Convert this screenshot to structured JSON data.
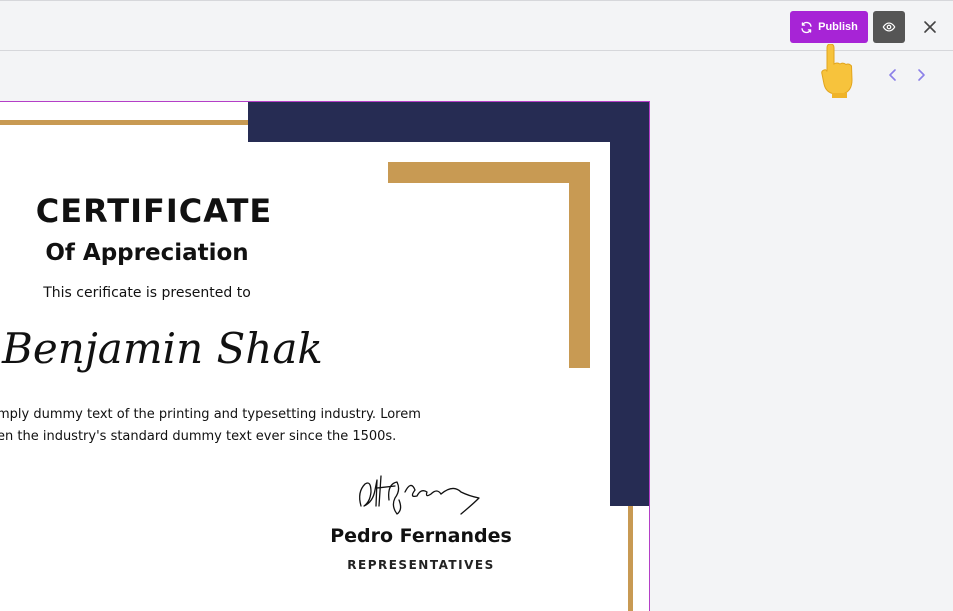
{
  "toolbar": {
    "publish_label": "Publish",
    "icons": {
      "publish": "refresh-icon",
      "preview": "eye-icon",
      "close": "close-icon",
      "prev": "chevron-left-icon",
      "next": "chevron-right-icon",
      "pointer": "pointing-hand-icon"
    }
  },
  "certificate": {
    "title": "CERTIFICATE",
    "subtitle": "Of Appreciation",
    "presented_to": "This cerificate is presented to",
    "recipient_name": "Benjamin Shak",
    "body_line_1": "mply dummy text of the printing and typesetting industry. Lorem",
    "body_line_2": "en the industry's standard dummy text ever since the 1500s.",
    "representative_name": "Pedro Fernandes",
    "representative_title": "REPRESENTATIVES"
  },
  "colors": {
    "accent": "#a724d6",
    "navy": "#262c53",
    "gold": "#c89a53",
    "canvas_border": "#b43fc7",
    "nav_arrow": "#8b80e8"
  }
}
